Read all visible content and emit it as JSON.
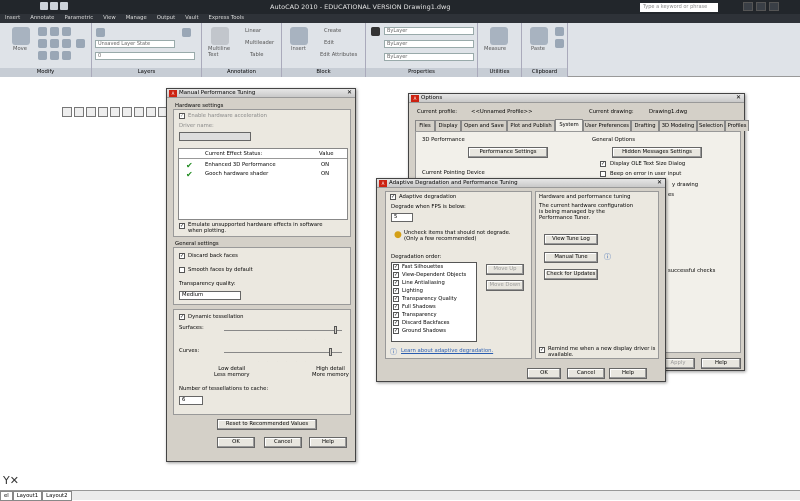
{
  "titlebar": {
    "title": "AutoCAD 2010 - EDUCATIONAL VERSION    Drawing1.dwg",
    "search_placeholder": "Type a keyword or phrase"
  },
  "menu": [
    "Insert",
    "Annotate",
    "Parametric",
    "View",
    "Manage",
    "Output",
    "Vault",
    "Express Tools"
  ],
  "ribbon": {
    "panels": [
      "Modify",
      "Layers",
      "Annotation",
      "Block",
      "Properties",
      "Utilities",
      "Clipboard"
    ],
    "modify_move": "Move",
    "layer_state": "Unsaved Layer State",
    "layer_value": "0",
    "multiline_text": "Multiline\nText",
    "linear": "Linear",
    "multileader": "Multileader",
    "table": "Table",
    "insert": "Insert",
    "create": "Create",
    "edit": "Edit",
    "edit_attributes": "Edit Attributes",
    "bylayer_color": "ByLayer",
    "bylayer_linetype": "ByLayer",
    "bylayer_lineweight": "ByLayer",
    "measure": "Measure",
    "paste": "Paste"
  },
  "mpt": {
    "title": "Manual Performance Tuning",
    "hw_section": "Hardware settings",
    "enable_hw": "Enable hardware acceleration",
    "driver_name": "Driver name:",
    "col_effect": "Current Effect Status:",
    "col_value": "Value",
    "effects": [
      {
        "name": "Enhanced 3D Performance",
        "value": "ON"
      },
      {
        "name": "Gooch hardware shader",
        "value": "ON"
      }
    ],
    "emulate": "Emulate unsupported hardware effects in software when plotting.",
    "general_section": "General settings",
    "discard": "Discard back faces",
    "smooth": "Smooth faces by default",
    "transparency_label": "Transparency quality:",
    "transparency_value": "Medium",
    "dynamic_tess": "Dynamic tessellation",
    "surfaces": "Surfaces:",
    "curves": "Curves:",
    "low_detail": "Low detail\nLess memory",
    "high_detail": "High detail\nMore memory",
    "num_tess": "Number of tessellations to cache:",
    "num_tess_value": "6",
    "reset": "Reset to Recommended Values",
    "ok": "OK",
    "cancel": "Cancel",
    "help": "Help"
  },
  "options": {
    "title": "Options",
    "current_profile_label": "Current profile:",
    "current_profile_value": "<<Unnamed Profile>>",
    "current_drawing_label": "Current drawing:",
    "current_drawing_value": "Drawing1.dwg",
    "tabs": [
      "Files",
      "Display",
      "Open and Save",
      "Plot and Publish",
      "System",
      "User Preferences",
      "Drafting",
      "3D Modeling",
      "Selection",
      "Profiles"
    ],
    "perf_group": "3D Performance",
    "perf_settings": "Performance Settings",
    "pointing_group": "Current Pointing Device",
    "general_group": "General Options",
    "hidden_msgs": "Hidden Messages Settings",
    "display_ole": "Display OLE Text Size Dialog",
    "beep": "Beep on error in user input",
    "frag_drawing": "y drawing",
    "frag_ws": "es",
    "frag_checks": "successful checks",
    "apply": "Apply",
    "help": "Help"
  },
  "adpt": {
    "title": "Adaptive Degradation and Performance Tuning",
    "adaptive": "Adaptive degradation",
    "degrade_fps": "Degrade when FPS is below:",
    "fps_value": "5",
    "uncheck_note": "Uncheck items that should not degrade.\n(Only a few recommended)",
    "order_label": "Degradation order:",
    "order": [
      "Fast Silhouettes",
      "View-Dependent Objects",
      "Line Antialiasing",
      "Lighting",
      "Transparency Quality",
      "Full Shadows",
      "Transparency",
      "Discard Backfaces",
      "Ground Shadows"
    ],
    "move_up": "Move Up",
    "move_down": "Move Down",
    "learn_link": "Learn about adaptive degradation.",
    "hw_tuning": "Hardware and performance tuning",
    "hw_desc": "The current hardware configuration\nis being managed by the\nPerformance Tuner.",
    "view_log": "View Tune Log",
    "manual_tune": "Manual Tune",
    "check_updates": "Check for Updates",
    "remind": "Remind me when a new display driver is available.",
    "ok": "OK",
    "cancel": "Cancel",
    "help": "Help"
  },
  "layout_tabs": [
    "el",
    "Layout1",
    "Layout2"
  ],
  "colors": {
    "accent_red": "#cc2211",
    "check_green": "#1e8a1e",
    "dialog_bg": "#d4d0c8"
  }
}
